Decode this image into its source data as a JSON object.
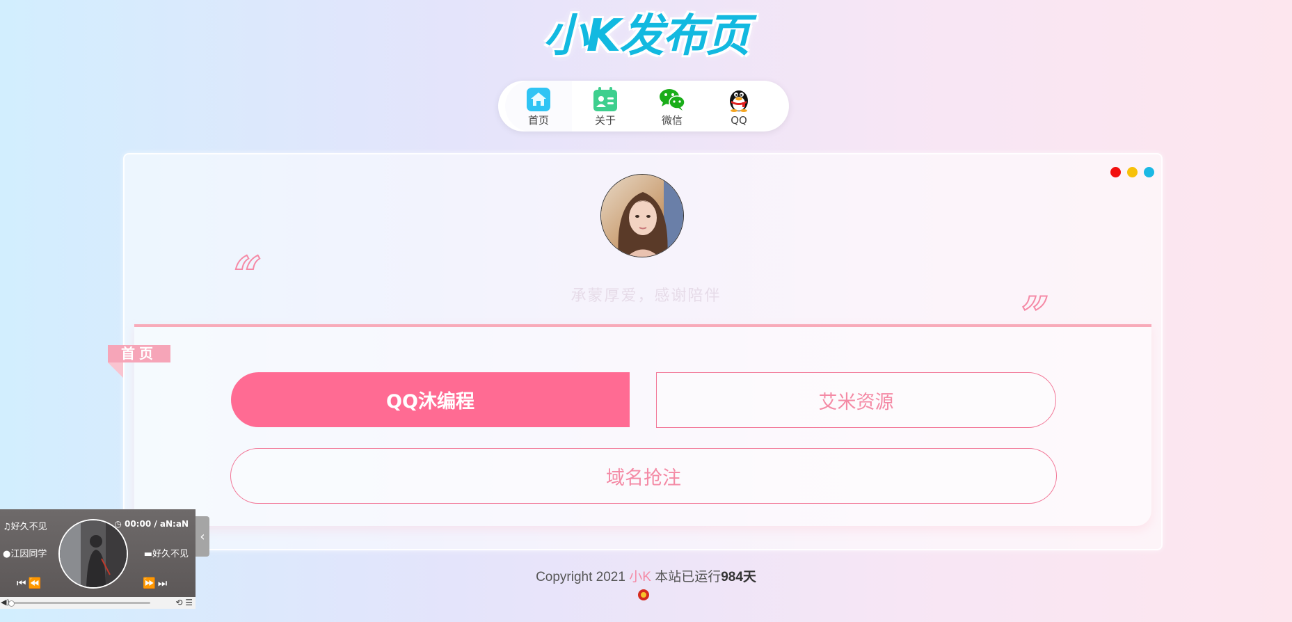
{
  "site": {
    "title": "小K发布页"
  },
  "nav": {
    "items": [
      {
        "label": "首页",
        "icon": "home-icon"
      },
      {
        "label": "关于",
        "icon": "about-card-icon"
      },
      {
        "label": "微信",
        "icon": "wechat-icon"
      },
      {
        "label": "QQ",
        "icon": "qq-penguin-icon"
      }
    ]
  },
  "card": {
    "window_dots": [
      "#f20f0f",
      "#f7c10a",
      "#1bb8e4"
    ],
    "motto": "承蒙厚爱，感谢陪伴",
    "quote_open": "“",
    "quote_close": "”",
    "ribbon": "首页"
  },
  "links": {
    "primary": "QQ沐编程",
    "secondary": "艾米资源",
    "wide": "域名抢注"
  },
  "footer": {
    "copyright": "Copyright 2021",
    "brand": "小K",
    "running_prefix": "本站已运行",
    "running_days": "984天"
  },
  "player": {
    "song": "好久不见",
    "time": "00:00 / aN:aN",
    "artist": "江因同学",
    "album": "好久不见",
    "progress": 0.0,
    "colors": {
      "accent": "#ff6b93",
      "brand_blue": "#12b9e0",
      "pink": "#f48aa5"
    }
  }
}
